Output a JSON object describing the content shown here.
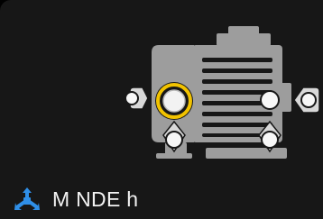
{
  "sensor": {
    "label": "M NDE h",
    "icon": "axes-3d-icon",
    "accent": "#2f8fe8",
    "selected_ring": "#f2c300"
  },
  "motor": {
    "icon": "electric-motor-icon",
    "fill": "#9d9d9d"
  }
}
